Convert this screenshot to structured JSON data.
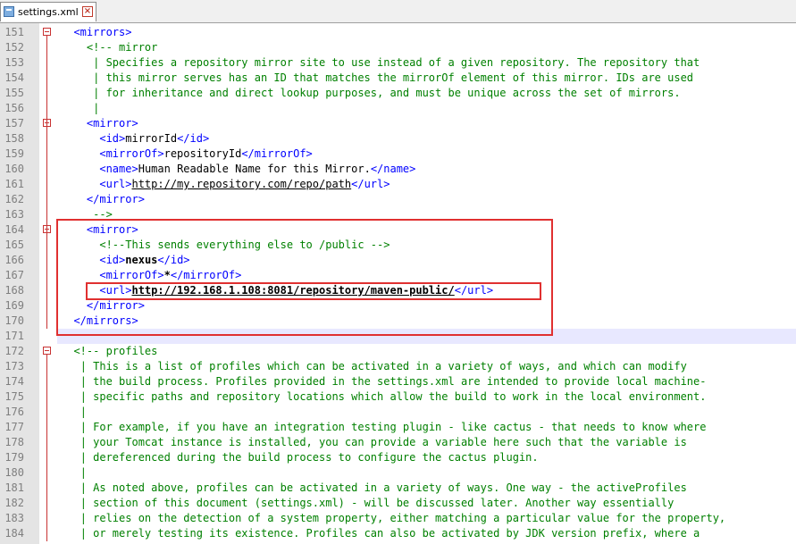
{
  "tab": {
    "filename": "settings.xml",
    "file_icon": "xml-file-icon",
    "close_icon": "close-icon"
  },
  "colors": {
    "tag": "#0000ff",
    "comment": "#008000",
    "text": "#000000",
    "gutter": "#e4e4e4",
    "fold": "#c83232",
    "highlight_box": "#e03030",
    "current_line": "#e8e8ff"
  },
  "lines": [
    {
      "n": "151",
      "fold": "open",
      "indent": "  ",
      "parts": [
        [
          "tag",
          "<mirrors>"
        ]
      ]
    },
    {
      "n": "152",
      "indent": "    ",
      "parts": [
        [
          "cmt",
          "<!-- mirror"
        ]
      ]
    },
    {
      "n": "153",
      "indent": "     ",
      "parts": [
        [
          "cmt",
          "| Specifies a repository mirror site to use instead of a given repository. The repository that"
        ]
      ]
    },
    {
      "n": "154",
      "indent": "     ",
      "parts": [
        [
          "cmt",
          "| this mirror serves has an ID that matches the mirrorOf element of this mirror. IDs are used"
        ]
      ]
    },
    {
      "n": "155",
      "indent": "     ",
      "parts": [
        [
          "cmt",
          "| for inheritance and direct lookup purposes, and must be unique across the set of mirrors."
        ]
      ]
    },
    {
      "n": "156",
      "indent": "     ",
      "parts": [
        [
          "cmt",
          "|"
        ]
      ]
    },
    {
      "n": "157",
      "fold": "open",
      "indent": "    ",
      "parts": [
        [
          "tag",
          "<mirror>"
        ]
      ]
    },
    {
      "n": "158",
      "indent": "      ",
      "parts": [
        [
          "tag",
          "<id>"
        ],
        [
          "txt",
          "mirrorId"
        ],
        [
          "tag",
          "</id>"
        ]
      ]
    },
    {
      "n": "159",
      "indent": "      ",
      "parts": [
        [
          "tag",
          "<mirrorOf>"
        ],
        [
          "txt",
          "repositoryId"
        ],
        [
          "tag",
          "</mirrorOf>"
        ]
      ]
    },
    {
      "n": "160",
      "indent": "      ",
      "parts": [
        [
          "tag",
          "<name>"
        ],
        [
          "txt",
          "Human Readable Name for this Mirror."
        ],
        [
          "tag",
          "</name>"
        ]
      ]
    },
    {
      "n": "161",
      "indent": "      ",
      "parts": [
        [
          "tag",
          "<url>"
        ],
        [
          "url",
          "http://my.repository.com/repo/path"
        ],
        [
          "tag",
          "</url>"
        ]
      ]
    },
    {
      "n": "162",
      "indent": "    ",
      "parts": [
        [
          "tag",
          "</mirror>"
        ]
      ]
    },
    {
      "n": "163",
      "indent": "     ",
      "parts": [
        [
          "cmt",
          "-->"
        ]
      ]
    },
    {
      "n": "164",
      "fold": "open",
      "indent": "    ",
      "parts": [
        [
          "tag",
          "<mirror>"
        ]
      ]
    },
    {
      "n": "165",
      "indent": "      ",
      "parts": [
        [
          "cmt",
          "<!--This sends everything else to /public -->"
        ]
      ]
    },
    {
      "n": "166",
      "indent": "      ",
      "parts": [
        [
          "tag",
          "<id>"
        ],
        [
          "bold",
          "nexus"
        ],
        [
          "tag",
          "</id>"
        ]
      ]
    },
    {
      "n": "167",
      "indent": "      ",
      "parts": [
        [
          "tag",
          "<mirrorOf>"
        ],
        [
          "bold",
          "*"
        ],
        [
          "tag",
          "</mirrorOf>"
        ]
      ]
    },
    {
      "n": "168",
      "indent": "      ",
      "parts": [
        [
          "tag",
          "<url>"
        ],
        [
          "boldurl",
          "http://192.168.1.108:8081/repository/maven-public/"
        ],
        [
          "tag",
          "</url>"
        ]
      ]
    },
    {
      "n": "169",
      "indent": "    ",
      "parts": [
        [
          "tag",
          "</mirror>"
        ]
      ]
    },
    {
      "n": "170",
      "indent": "  ",
      "parts": [
        [
          "tag",
          "</mirrors>"
        ]
      ]
    },
    {
      "n": "171",
      "current": true,
      "indent": "",
      "parts": []
    },
    {
      "n": "172",
      "fold": "open",
      "indent": "  ",
      "parts": [
        [
          "cmt",
          "<!-- profiles"
        ]
      ]
    },
    {
      "n": "173",
      "indent": "   ",
      "parts": [
        [
          "cmt",
          "| This is a list of profiles which can be activated in a variety of ways, and which can modify"
        ]
      ]
    },
    {
      "n": "174",
      "indent": "   ",
      "parts": [
        [
          "cmt",
          "| the build process. Profiles provided in the settings.xml are intended to provide local machine-"
        ]
      ]
    },
    {
      "n": "175",
      "indent": "   ",
      "parts": [
        [
          "cmt",
          "| specific paths and repository locations which allow the build to work in the local environment."
        ]
      ]
    },
    {
      "n": "176",
      "indent": "   ",
      "parts": [
        [
          "cmt",
          "|"
        ]
      ]
    },
    {
      "n": "177",
      "indent": "   ",
      "parts": [
        [
          "cmt",
          "| For example, if you have an integration testing plugin - like cactus - that needs to know where"
        ]
      ]
    },
    {
      "n": "178",
      "indent": "   ",
      "parts": [
        [
          "cmt",
          "| your Tomcat instance is installed, you can provide a variable here such that the variable is"
        ]
      ]
    },
    {
      "n": "179",
      "indent": "   ",
      "parts": [
        [
          "cmt",
          "| dereferenced during the build process to configure the cactus plugin."
        ]
      ]
    },
    {
      "n": "180",
      "indent": "   ",
      "parts": [
        [
          "cmt",
          "|"
        ]
      ]
    },
    {
      "n": "181",
      "indent": "   ",
      "parts": [
        [
          "cmt",
          "| As noted above, profiles can be activated in a variety of ways. One way - the activeProfiles"
        ]
      ]
    },
    {
      "n": "182",
      "indent": "   ",
      "parts": [
        [
          "cmt",
          "| section of this document (settings.xml) - will be discussed later. Another way essentially"
        ]
      ]
    },
    {
      "n": "183",
      "indent": "   ",
      "parts": [
        [
          "cmt",
          "| relies on the detection of a system property, either matching a particular value for the property,"
        ]
      ]
    },
    {
      "n": "184",
      "indent": "   ",
      "parts": [
        [
          "cmt",
          "| or merely testing its existence. Profiles can also be activated by JDK version prefix, where a"
        ]
      ]
    }
  ]
}
